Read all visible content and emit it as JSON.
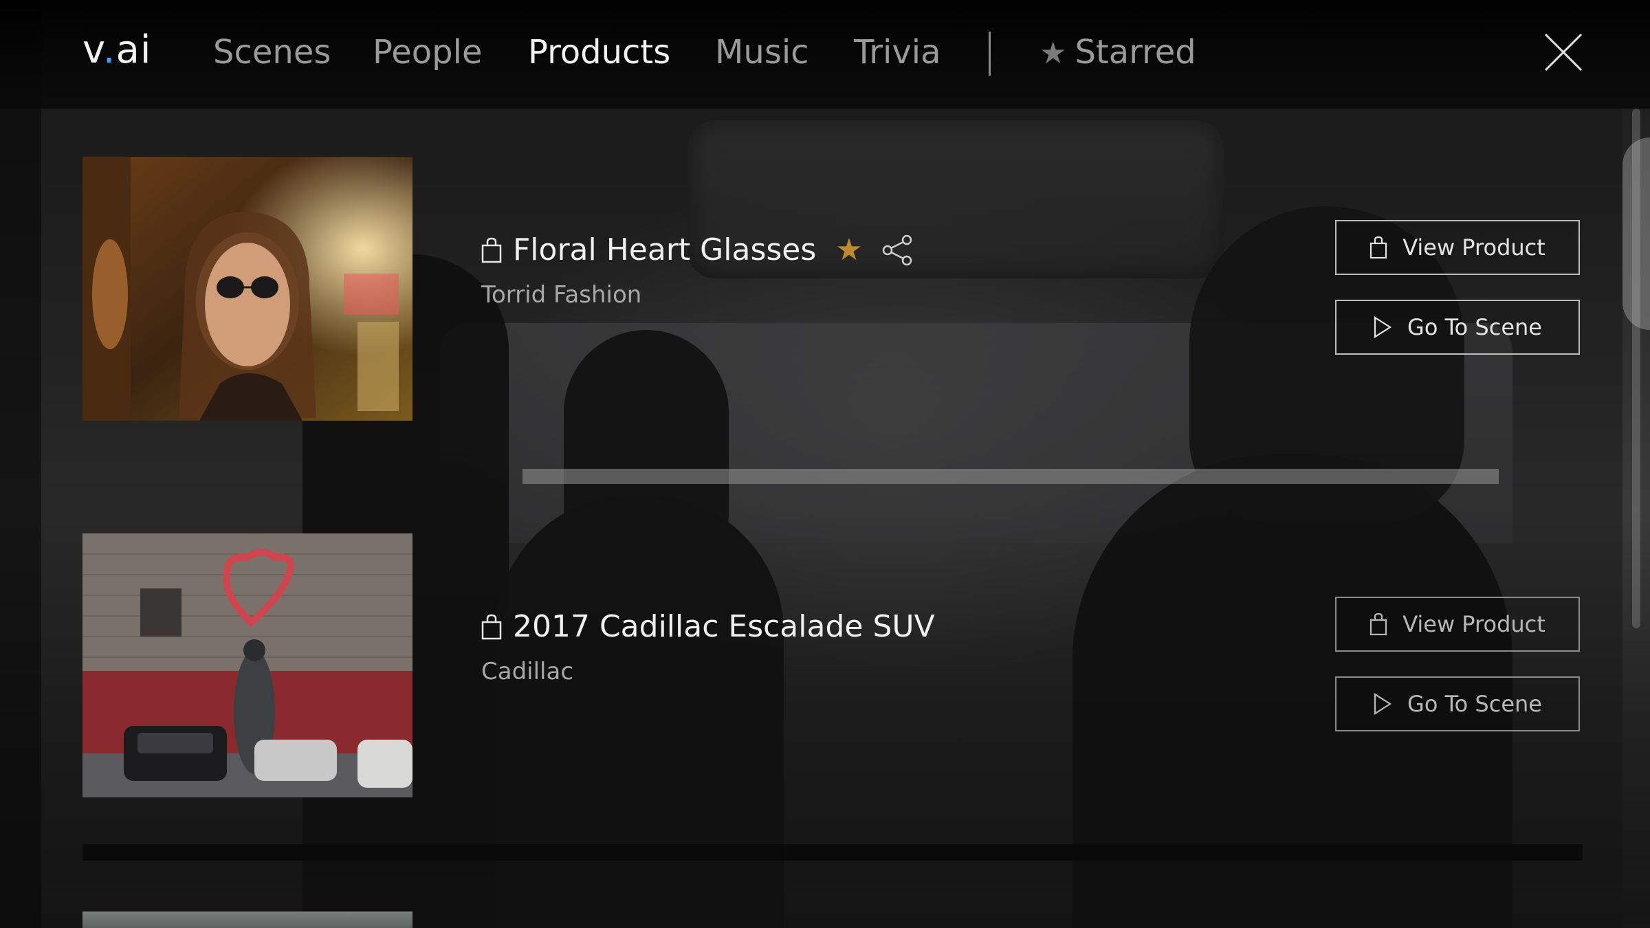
{
  "logo": {
    "prefix": "v",
    "dot": ".",
    "suffix": "ai"
  },
  "nav": {
    "items": [
      {
        "label": "Scenes",
        "active": false
      },
      {
        "label": "People",
        "active": false
      },
      {
        "label": "Products",
        "active": true
      },
      {
        "label": "Music",
        "active": false
      },
      {
        "label": "Trivia",
        "active": false
      }
    ],
    "starred_label": "Starred",
    "close_icon": "close-icon"
  },
  "products": [
    {
      "title": "Floral Heart Glasses",
      "brand": "Torrid Fashion",
      "starred": true,
      "shareable": true,
      "view_label": "View Product",
      "scene_label": "Go To Scene"
    },
    {
      "title": "2017 Cadillac Escalade SUV",
      "brand": "Cadillac",
      "starred": false,
      "shareable": false,
      "view_label": "View Product",
      "scene_label": "Go To Scene"
    }
  ],
  "colors": {
    "accent_star": "#c08a2a",
    "logo_dot": "#3aa0ff",
    "nav_active": "#f2f2f2",
    "nav_inactive": "#9a9a9a"
  }
}
